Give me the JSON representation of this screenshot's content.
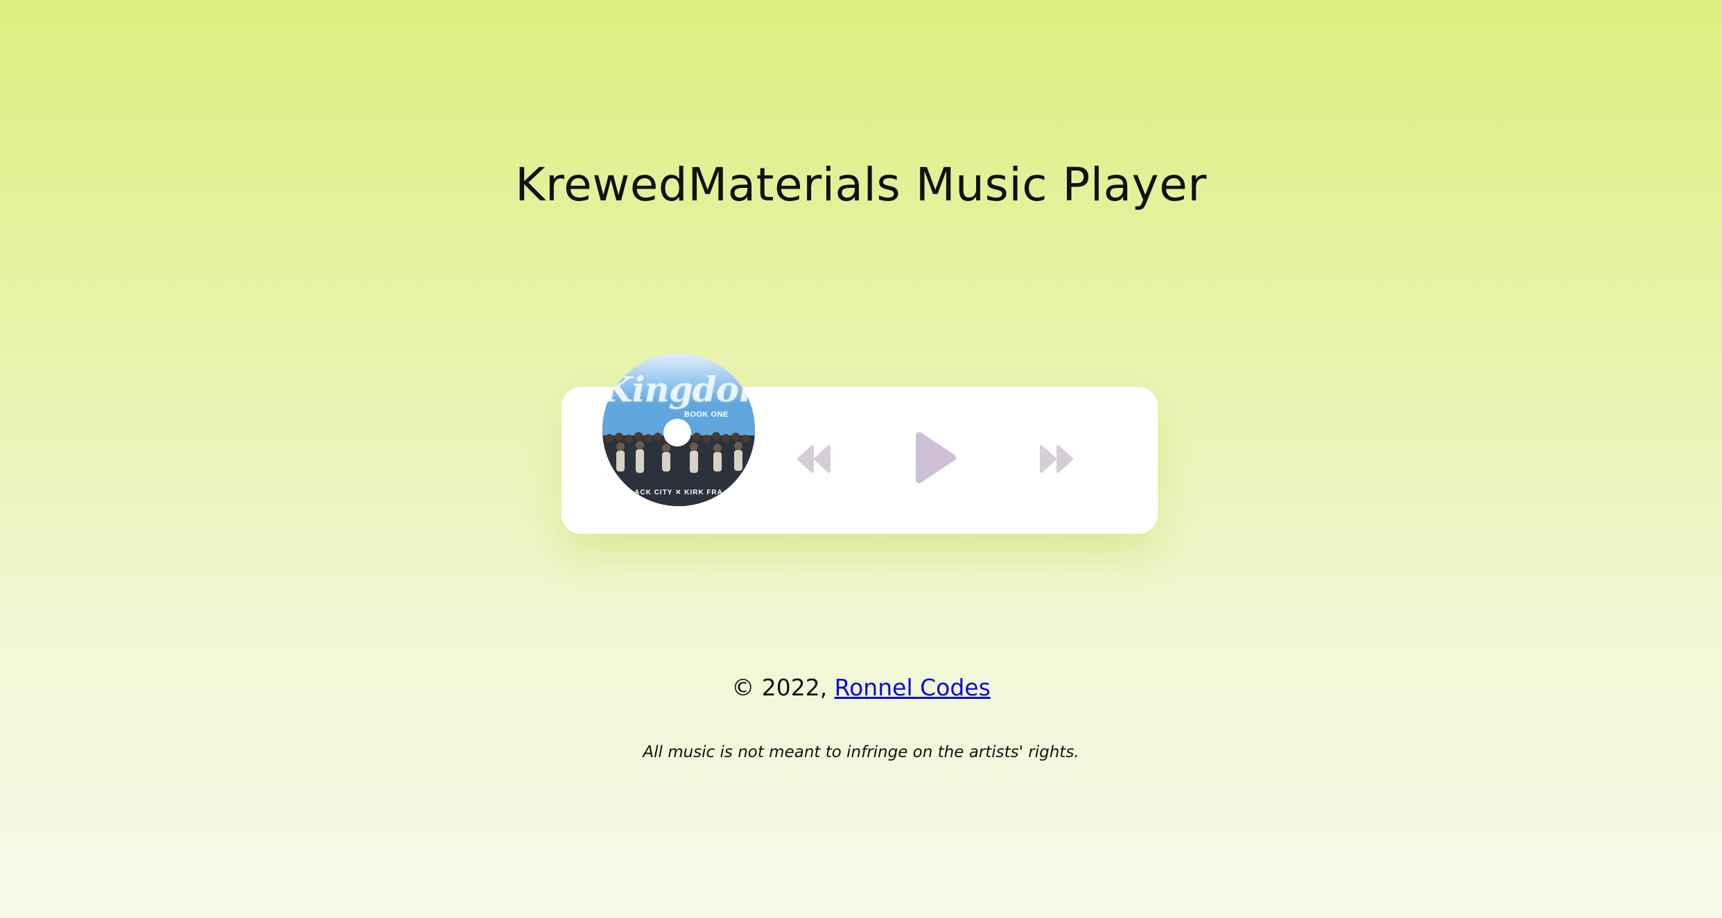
{
  "header": {
    "title": "KrewedMaterials Music Player"
  },
  "player": {
    "album_art": {
      "title_text": "Kingdom",
      "subtitle_text": "BOOK ONE",
      "credits_text": "ACK CITY ✕ KIRK FRA"
    },
    "controls": {
      "previous_icon": "rewind-icon",
      "play_icon": "play-icon",
      "next_icon": "fast-forward-icon"
    },
    "colors": {
      "control_color": "#d3c9d8",
      "play_color": "#cdbfd6",
      "card_background": "#ffffff"
    }
  },
  "footer": {
    "copyright": "© 2022, ",
    "author_link": "Ronnel Codes",
    "disclaimer": "All music is not meant to infringe on the artists' rights."
  }
}
